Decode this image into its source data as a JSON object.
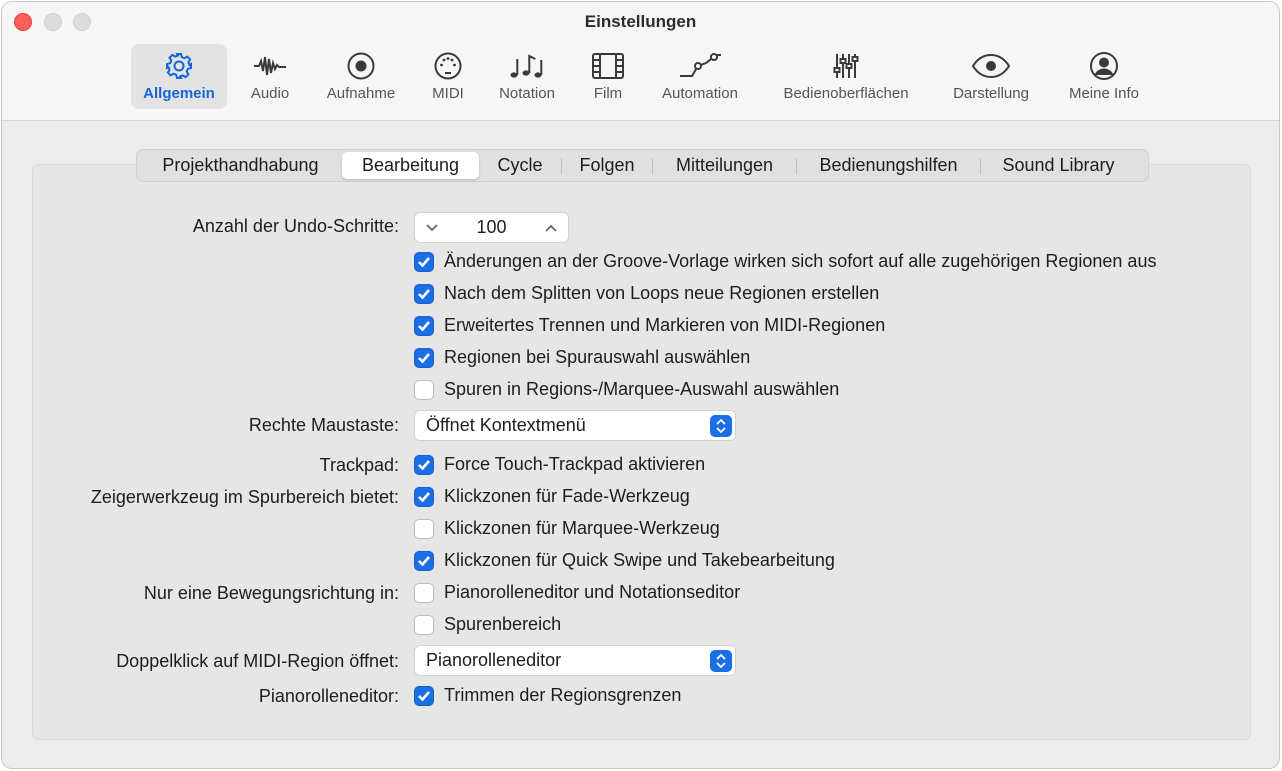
{
  "window": {
    "title": "Einstellungen"
  },
  "toolbar": {
    "items": [
      {
        "label": "Allgemein",
        "icon": "gear-icon",
        "active": true
      },
      {
        "label": "Audio",
        "icon": "waveform-icon"
      },
      {
        "label": "Aufnahme",
        "icon": "record-icon"
      },
      {
        "label": "MIDI",
        "icon": "midi-port-icon"
      },
      {
        "label": "Notation",
        "icon": "music-notes-icon"
      },
      {
        "label": "Film",
        "icon": "film-strip-icon"
      },
      {
        "label": "Automation",
        "icon": "automation-curve-icon"
      },
      {
        "label": "Bedienoberflächen",
        "icon": "sliders-icon"
      },
      {
        "label": "Darstellung",
        "icon": "eye-icon"
      },
      {
        "label": "Meine Info",
        "icon": "person-circle-icon"
      }
    ],
    "accent_color": "#1565d8"
  },
  "tabs": [
    {
      "label": "Projekthandhabung"
    },
    {
      "label": "Bearbeitung",
      "active": true
    },
    {
      "label": "Cycle"
    },
    {
      "label": "Folgen"
    },
    {
      "label": "Mitteilungen"
    },
    {
      "label": "Bedienungshilfen"
    },
    {
      "label": "Sound Library"
    }
  ],
  "settings": {
    "undo": {
      "label": "Anzahl der Undo-Schritte:",
      "value": "100"
    },
    "region_checks": [
      {
        "label": "Änderungen an der Groove-Vorlage wirken sich sofort auf alle zugehörigen Regionen aus",
        "checked": true
      },
      {
        "label": "Nach dem Splitten von Loops neue Regionen erstellen",
        "checked": true
      },
      {
        "label": "Erweitertes Trennen und Markieren von MIDI-Regionen",
        "checked": true
      },
      {
        "label": "Regionen bei Spurauswahl auswählen",
        "checked": true
      },
      {
        "label": "Spuren in Regions-/Marquee-Auswahl auswählen",
        "checked": false
      }
    ],
    "right_mouse": {
      "label": "Rechte Maustaste:",
      "value": "Öffnet Kontextmenü"
    },
    "trackpad": {
      "label": "Trackpad:",
      "option": "Force Touch-Trackpad aktivieren",
      "checked": true
    },
    "pointer_tool": {
      "label": "Zeigerwerkzeug im Spurbereich bietet:",
      "options": [
        {
          "label": "Klickzonen für Fade-Werkzeug",
          "checked": true
        },
        {
          "label": "Klickzonen für Marquee-Werkzeug",
          "checked": false
        },
        {
          "label": "Klickzonen für Quick Swipe und Takebearbeitung",
          "checked": true
        }
      ]
    },
    "one_direction": {
      "label": "Nur eine Bewegungsrichtung in:",
      "options": [
        {
          "label": "Pianorolleneditor und Notationseditor",
          "checked": false
        },
        {
          "label": "Spurenbereich",
          "checked": false
        }
      ]
    },
    "double_click": {
      "label": "Doppelklick auf MIDI-Region öffnet:",
      "value": "Pianorolleneditor"
    },
    "piano_roll": {
      "label": "Pianorolleneditor:",
      "option": "Trimmen der Regionsgrenzen",
      "checked": true
    }
  },
  "colors": {
    "checkbox_on": "#1a6fe6",
    "close_button": "#fe5f57"
  }
}
